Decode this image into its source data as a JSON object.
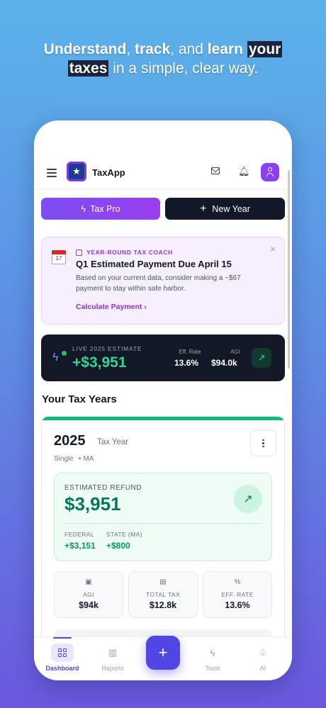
{
  "headline": {
    "w1": "Understand",
    "w2": ", ",
    "w3": "track",
    "w4": ", and ",
    "w5": "learn",
    "w6": " ",
    "w7": "your",
    "w8": "taxes",
    "w9": " in a simple, clear way."
  },
  "app": {
    "title": "TaxApp",
    "icons": [
      "menu-icon",
      "app-logo",
      "mail-icon",
      "bell-icon",
      "user-icon"
    ]
  },
  "actions": {
    "pro_label": "Tax Pro",
    "new_label": "New Year"
  },
  "coach": {
    "kicker": "YEAR-ROUND TAX COACH",
    "calendar_day": "17",
    "title": "Q1 Estimated Payment Due April 15",
    "body": "Based on your current data, consider making a ~$67 payment to stay within safe harbor.",
    "link": "Calculate Payment",
    "close": "×"
  },
  "live": {
    "label": "LIVE 2025 ESTIMATE",
    "value": "+$3,951",
    "eff_rate_label": "Eff. Rate",
    "eff_rate": "13.6%",
    "agi_label": "AGI",
    "agi": "$94.0k"
  },
  "section_title": "Your Tax Years",
  "year_card": {
    "year": "2025",
    "year_label": "Tax Year",
    "filing": "Single",
    "state": "MA",
    "refund_label": "ESTIMATED REFUND",
    "refund_value": "$3,951",
    "federal_label": "FEDERAL",
    "federal_value": "+$3,151",
    "state_label": "STATE (MA)",
    "state_value": "+$800",
    "stats": [
      {
        "icon": "wallet-icon",
        "label": "AGI",
        "value": "$94k"
      },
      {
        "icon": "document-icon",
        "label": "TOTAL TAX",
        "value": "$12.8k"
      },
      {
        "icon": "percent-icon",
        "label": "EFF. RATE",
        "value": "13.6%"
      }
    ]
  },
  "tabs": [
    {
      "label": "Dashboard",
      "icon": "grid-icon",
      "active": true
    },
    {
      "label": "Reports",
      "icon": "bar-chart-icon"
    },
    {
      "label": "Tools",
      "icon": "bolt-icon"
    },
    {
      "label": "AI",
      "icon": "brain-icon"
    }
  ],
  "fab_label": "+",
  "colors": {
    "accent": "#4f46e5",
    "pro_gradient": [
      "#7c4df0",
      "#9b3ef0"
    ],
    "positive": "#047857",
    "dark_card": "#121826"
  }
}
